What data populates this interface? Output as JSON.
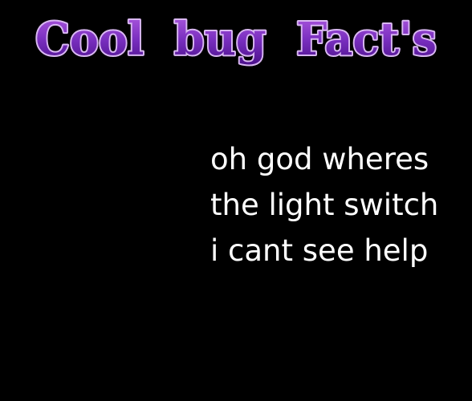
{
  "title": "Cool  bug  Fact's",
  "title_colors": {
    "top": "#b05be0",
    "middle": "#7a2fc0",
    "bottom": "#4a0f8a",
    "outline": "#d9b7f2"
  },
  "background_color": "#000000",
  "caption_color": "#ffffff",
  "caption": {
    "lines": [
      "oh god wheres",
      "the light switch",
      "i cant see help"
    ]
  }
}
